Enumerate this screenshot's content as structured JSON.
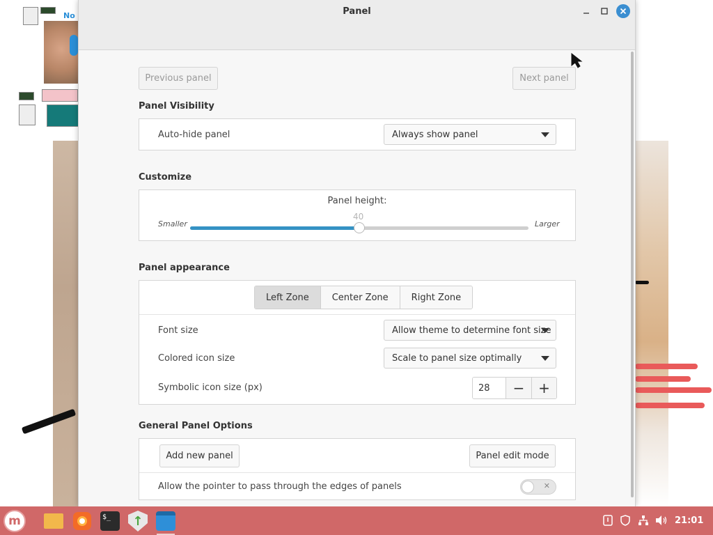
{
  "window": {
    "title": "Panel"
  },
  "nav": {
    "previous": "Previous panel",
    "next": "Next panel"
  },
  "visibility": {
    "heading": "Panel Visibility",
    "autohide_label": "Auto-hide panel",
    "autohide_value": "Always show panel"
  },
  "customize": {
    "heading": "Customize",
    "height_label": "Panel height:",
    "height_value": "40",
    "smaller": "Smaller",
    "larger": "Larger",
    "slider_fraction": 0.5
  },
  "appearance": {
    "heading": "Panel appearance",
    "zones": [
      "Left Zone",
      "Center Zone",
      "Right Zone"
    ],
    "active_zone": "Left Zone",
    "font_size_label": "Font size",
    "font_size_value": "Allow theme to determine font size",
    "colored_icon_label": "Colored icon size",
    "colored_icon_value": "Scale to panel size optimally",
    "symbolic_icon_label": "Symbolic icon size (px)",
    "symbolic_icon_value": "28",
    "minus": "−",
    "plus": "+"
  },
  "general": {
    "heading": "General Panel Options",
    "add_panel": "Add new panel",
    "edit_mode": "Panel edit mode",
    "pass_through_label": "Allow the pointer to pass through the edges of panels",
    "pass_through_enabled": false
  },
  "taskbar": {
    "menu_icon": "mint-logo-icon",
    "apps": [
      "folder-icon",
      "firefox-icon",
      "terminal-icon",
      "update-manager-icon",
      "window-icon"
    ],
    "clock": "21:01",
    "accent": "#d06868"
  }
}
